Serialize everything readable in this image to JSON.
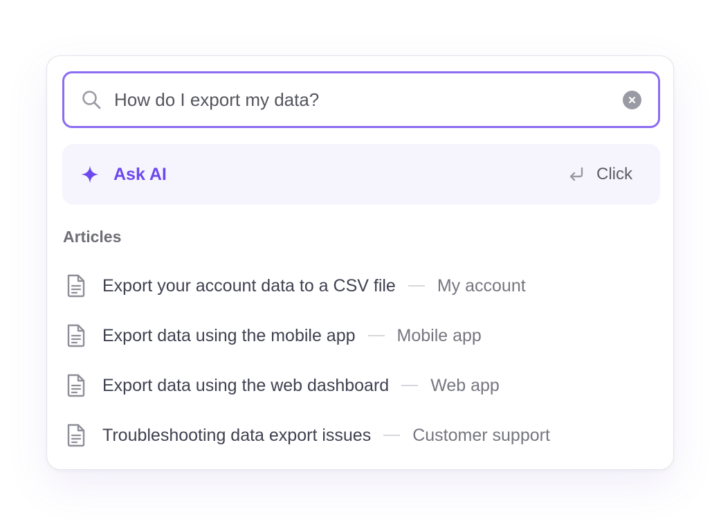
{
  "search": {
    "value": "How do I export my data?",
    "icon": "search-icon",
    "clear_icon": "close-icon"
  },
  "ask_ai": {
    "label": "Ask AI",
    "hint": "Click",
    "icon": "sparkle-icon",
    "hint_icon": "enter-key-icon"
  },
  "articles": {
    "title": "Articles",
    "items": [
      {
        "title": "Export your account data to a CSV file",
        "category": "My account"
      },
      {
        "title": "Export data using the mobile app",
        "category": "Mobile app"
      },
      {
        "title": "Export data using the web dashboard",
        "category": "Web app"
      },
      {
        "title": "Troubleshooting data export issues",
        "category": "Customer support"
      }
    ]
  },
  "colors": {
    "accent": "#6d48ee",
    "search_border": "#8b6bf2",
    "ask_ai_background": "#f6f5fd",
    "text_primary": "#3f4150",
    "text_secondary": "#767680"
  }
}
